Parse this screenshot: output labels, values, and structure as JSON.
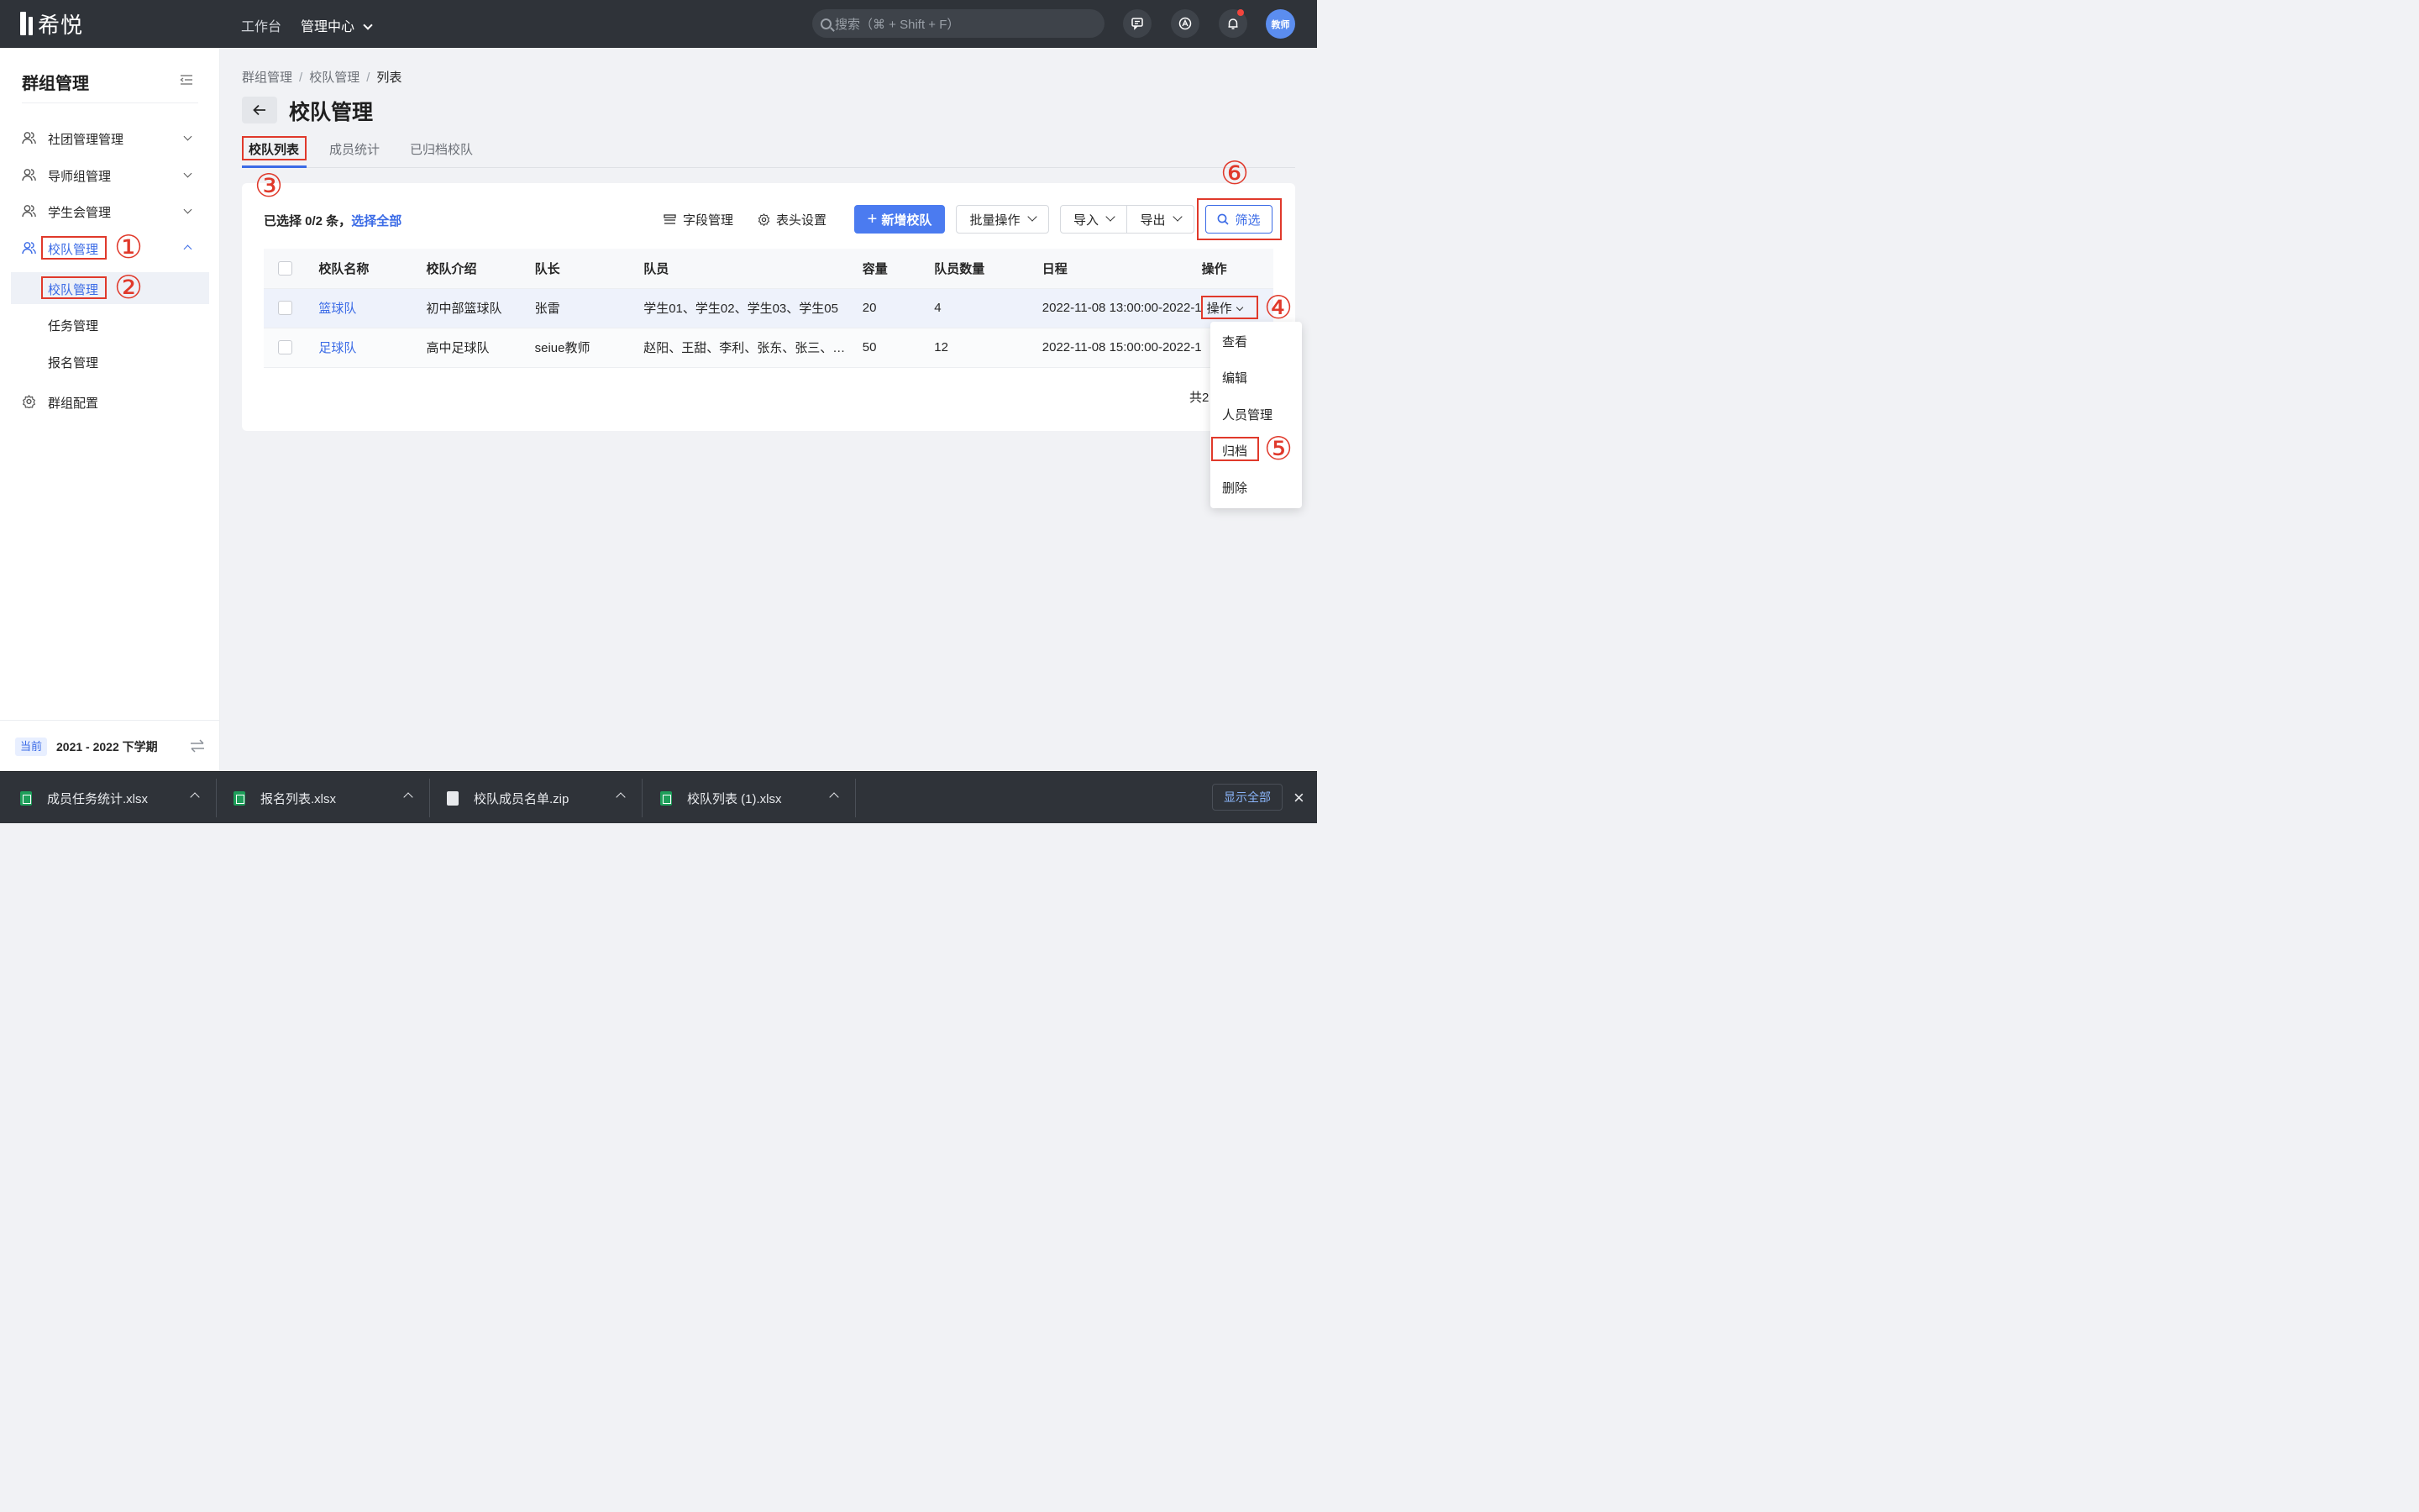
{
  "topbar": {
    "logo_text": "希悦",
    "nav": [
      {
        "label": "工作台"
      },
      {
        "label": "管理中心"
      }
    ],
    "search_placeholder": "搜索（⌘ + Shift + F）",
    "avatar_text": "教师"
  },
  "sidebar": {
    "title": "群组管理",
    "items": [
      {
        "label": "社团管理管理",
        "icon": "users-icon"
      },
      {
        "label": "导师组管理",
        "icon": "users-icon"
      },
      {
        "label": "学生会管理",
        "icon": "users-icon"
      },
      {
        "label": "校队管理",
        "icon": "users-icon"
      }
    ],
    "sub_items": [
      {
        "label": "校队管理"
      },
      {
        "label": "任务管理"
      },
      {
        "label": "报名管理"
      }
    ],
    "config_label": "群组配置",
    "footer": {
      "badge": "当前",
      "term": "2021 - 2022 下学期"
    }
  },
  "breadcrumb": [
    "群组管理",
    "校队管理",
    "列表"
  ],
  "page_title": "校队管理",
  "tabs": [
    {
      "label": "校队列表"
    },
    {
      "label": "成员统计"
    },
    {
      "label": "已归档校队"
    }
  ],
  "toolbar": {
    "selected_text": "已选择 0/2 条，",
    "select_all": "选择全部",
    "field_mgmt": "字段管理",
    "header_settings": "表头设置",
    "add_team": "新增校队",
    "batch": "批量操作",
    "import": "导入",
    "export": "导出",
    "filter": "筛选"
  },
  "table": {
    "headers": [
      "校队名称",
      "校队介绍",
      "队长",
      "队员",
      "容量",
      "队员数量",
      "日程",
      "操作"
    ],
    "rows": [
      {
        "name": "篮球队",
        "intro": "初中部篮球队",
        "captain": "张雷",
        "members": "学生01、学生02、学生03、学生05",
        "capacity": "20",
        "count": "4",
        "schedule": "2022-11-08 13:00:00-2022-1",
        "action": "操作"
      },
      {
        "name": "足球队",
        "intro": "高中足球队",
        "captain": "seiue教师",
        "members": "赵阳、王甜、李利、张东、张三、…",
        "capacity": "50",
        "count": "12",
        "schedule": "2022-11-08 15:00:00-2022-1",
        "action": ""
      }
    ],
    "total": "共2"
  },
  "dropdown": [
    "查看",
    "编辑",
    "人员管理",
    "归档",
    "删除"
  ],
  "annotations": [
    "①",
    "②",
    "③",
    "④",
    "⑤",
    "⑥"
  ],
  "downloads": [
    {
      "name": "成员任务统计.xlsx",
      "type": "xlsx"
    },
    {
      "name": "报名列表.xlsx",
      "type": "xlsx"
    },
    {
      "name": "校队成员名单.zip",
      "type": "zip"
    },
    {
      "name": "校队列表 (1).xlsx",
      "type": "xlsx"
    }
  ],
  "download_show_all": "显示全部",
  "colors": {
    "accent": "#3b6be6",
    "annotation_red": "#e0392b",
    "topbar": "#2f3339"
  }
}
